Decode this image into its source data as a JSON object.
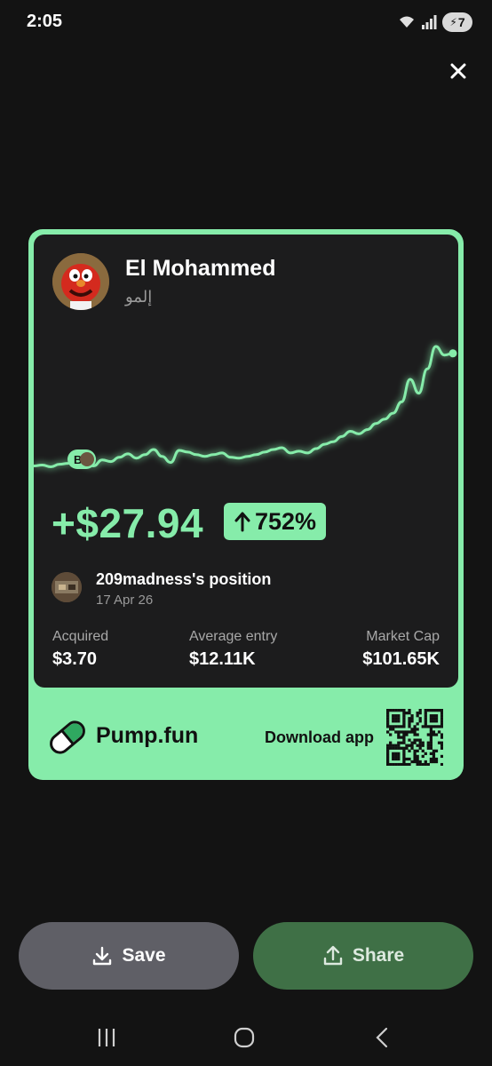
{
  "status_bar": {
    "time": "2:05",
    "battery_level": "7"
  },
  "card": {
    "token_name": "El Mohammed",
    "token_symbol": "إلمو",
    "entry_marker_label": "B",
    "pnl_value": "+$27.94",
    "pnl_percent": "752%",
    "trader_position": "209madness's position",
    "trader_date": "17 Apr 26",
    "stats": [
      {
        "label": "Acquired",
        "value": "$3.70"
      },
      {
        "label": "Average entry",
        "value": "$12.11K"
      },
      {
        "label": "Market Cap",
        "value": "$101.65K"
      }
    ],
    "brand_name": "Pump.fun",
    "download_label": "Download app"
  },
  "chart_data": {
    "type": "line",
    "series": [
      {
        "values": [
          20,
          21,
          19,
          22,
          23,
          26,
          22,
          20,
          27,
          25,
          30,
          34,
          29,
          33,
          39,
          31,
          24,
          38,
          36,
          33,
          31,
          33,
          35,
          30,
          29,
          31,
          33,
          36,
          39,
          41,
          35,
          37,
          35,
          40,
          45,
          48,
          54,
          60,
          57,
          62,
          69,
          74,
          81,
          94,
          120,
          104,
          132,
          158,
          148,
          150
        ]
      }
    ],
    "accent_color": "#86ecaa"
  },
  "actions": {
    "save_label": "Save",
    "share_label": "Share"
  },
  "colors": {
    "accent": "#86ecaa",
    "background": "#131313",
    "card": "#1c1c1d",
    "share_button": "#3f7046",
    "save_button": "#5f5f66"
  }
}
